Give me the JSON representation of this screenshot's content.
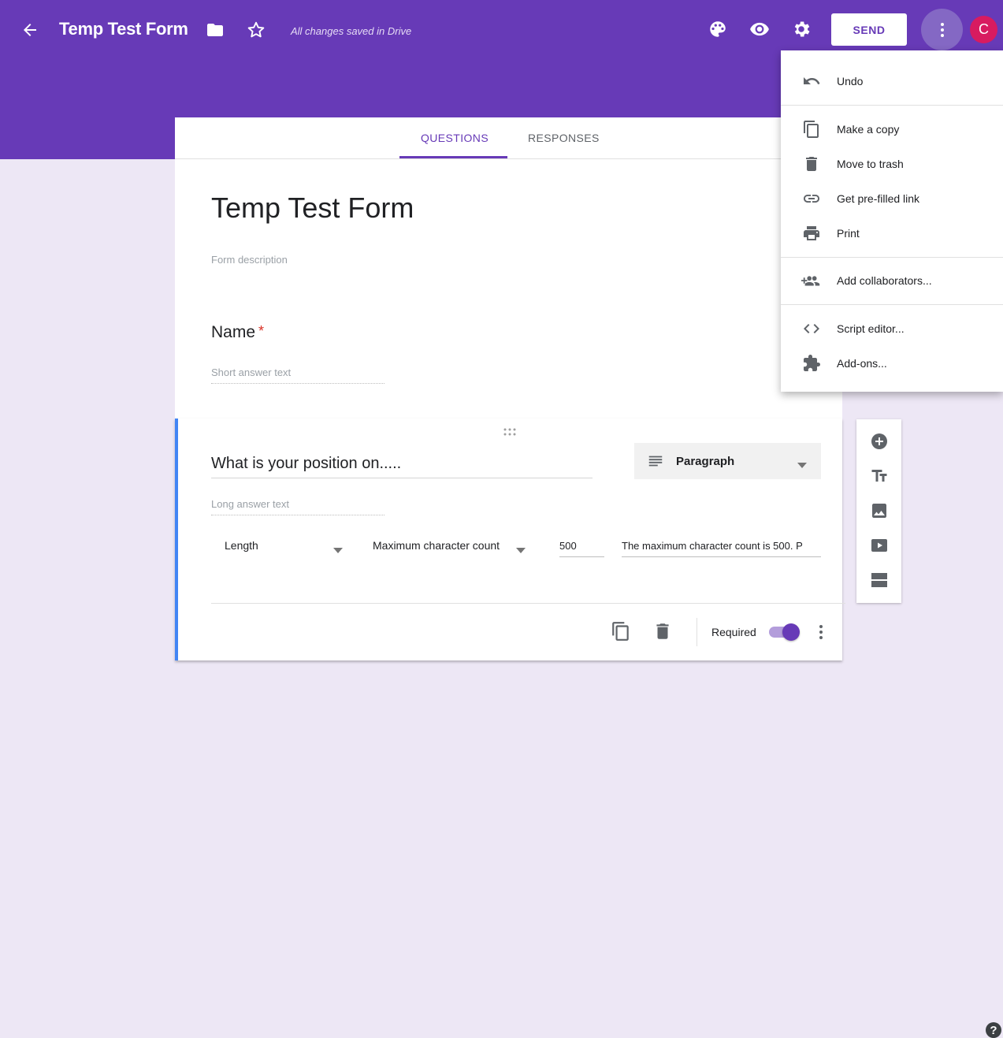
{
  "header": {
    "title": "Temp Test Form",
    "saved_status": "All changes saved in Drive",
    "send_label": "SEND",
    "avatar_initial": "C",
    "colors": {
      "primary": "#673ab7",
      "avatar": "#d81b60"
    }
  },
  "tabs": {
    "questions": "QUESTIONS",
    "responses": "RESPONSES",
    "active": "questions"
  },
  "form": {
    "title": "Temp Test Form",
    "description_placeholder": "Form description"
  },
  "questions": [
    {
      "title": "Name",
      "required_marker": "*",
      "answer_placeholder": "Short answer text"
    },
    {
      "title": "What is your position on.....",
      "type_label": "Paragraph",
      "answer_placeholder": "Long answer text",
      "validation": {
        "rule": "Length",
        "condition": "Maximum character count",
        "value": "500",
        "error_text": "The maximum character count is 500. P"
      },
      "required_label": "Required",
      "required": true
    }
  ],
  "menu": {
    "items": [
      {
        "label": "Undo",
        "icon": "undo-icon"
      },
      {
        "label": "Make a copy",
        "icon": "copy-icon"
      },
      {
        "label": "Move to trash",
        "icon": "trash-icon"
      },
      {
        "label": "Get pre-filled link",
        "icon": "link-icon"
      },
      {
        "label": "Print",
        "icon": "print-icon"
      },
      {
        "label": "Add collaborators...",
        "icon": "add-people-icon"
      },
      {
        "label": "Script editor...",
        "icon": "code-icon"
      },
      {
        "label": "Add-ons...",
        "icon": "puzzle-icon"
      }
    ]
  },
  "side_toolbar": {
    "buttons": [
      "add-question-icon",
      "title-text-icon",
      "image-icon",
      "video-icon",
      "section-icon"
    ]
  },
  "help": {
    "label": "?"
  }
}
